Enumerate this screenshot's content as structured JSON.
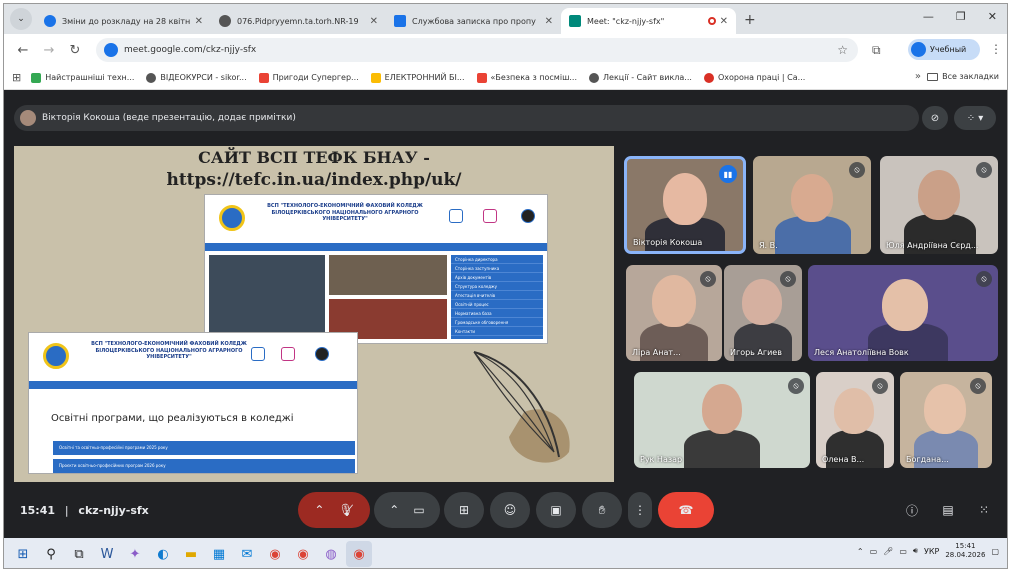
{
  "tabs": [
    {
      "title": "Зміни до розкладу на 28 квітн",
      "active": false,
      "color": "#1a73e8"
    },
    {
      "title": "076.Pidpryyemn.ta.torh.NR-19",
      "active": false,
      "color": "#555555"
    },
    {
      "title": "Службова записка про пропу",
      "active": false,
      "color": "#1a73e8"
    },
    {
      "title": "Meet: \"ckz-njjy-sfx\"",
      "active": true,
      "color": "#00897b"
    }
  ],
  "address": {
    "url": "meet.google.com/ckz-njjy-sfx"
  },
  "profile": {
    "label": "Учебный"
  },
  "bookmarks": [
    {
      "label": "Найстрашніші техн...",
      "color": "#34a853"
    },
    {
      "label": "ВІДЕОКУРСИ - sikor...",
      "color": "#555555"
    },
    {
      "label": "Пригоди Супергер...",
      "color": "#ea4335"
    },
    {
      "label": "ЕЛЕКТРОННИЙ БІ...",
      "color": "#fbbc04"
    },
    {
      "label": "«Безпека з посміш...",
      "color": "#ea4335"
    },
    {
      "label": "Лекції - Сайт викла...",
      "color": "#555555"
    },
    {
      "label": "Охорона праці | Са...",
      "color": "#d93025"
    }
  ],
  "bookmarks_all": "Все закладки",
  "presenter_bar": {
    "text": "Вікторія Кокоша (веде презентацію, додає примітки)"
  },
  "slide": {
    "title_line1": "САЙТ ВСП ТЕФК БНАУ -",
    "title_line2": "https://tefc.in.ua/index.php/uk/",
    "site_header": "ВСП \"ТЕХНОЛОГО-ЕКОНОМІЧНИЙ ФАХОВИЙ КОЛЕДЖ БІЛОЦЕРКІВСЬКОГО НАЦІОНАЛЬНОГО АГРАРНОГО УНІВЕРСИТЕТУ\"",
    "menu_items": [
      "Сторінка директора",
      "Сторінка заступника",
      "Архів документів",
      "Структура коледжу",
      "Атестація вчителів",
      "Освітній процес",
      "Нормативна база",
      "Громадське обговорення",
      "Контакти"
    ],
    "programs_heading": "Освітні програми, що реалізуються в коледжі",
    "program_links": [
      "Освітні та освітньо-професійні програми 2025 року",
      "Проєкти освітньо-професійних програм 2026 року"
    ]
  },
  "participants": [
    {
      "name": "Вікторія Кокоша",
      "speaking": true
    },
    {
      "name": "Я. В.",
      "muted": true
    },
    {
      "name": "Юля Андріївна Сєрд...",
      "muted": true
    },
    {
      "name": "Ліра Анат...",
      "muted": true
    },
    {
      "name": "Игорь Агиев",
      "muted": true
    },
    {
      "name": "Леся Анатоліївна Вовк",
      "muted": true
    },
    {
      "name": "Рук Назар",
      "muted": true
    },
    {
      "name": "Олена В...",
      "muted": true
    },
    {
      "name": "Богдана...",
      "muted": true
    }
  ],
  "meeting": {
    "time": "15:41",
    "code": "ckz-njjy-sfx",
    "separator": "|"
  },
  "taskbar": {
    "lang": "УКР",
    "time": "15:41",
    "date": "28.04.2026"
  }
}
